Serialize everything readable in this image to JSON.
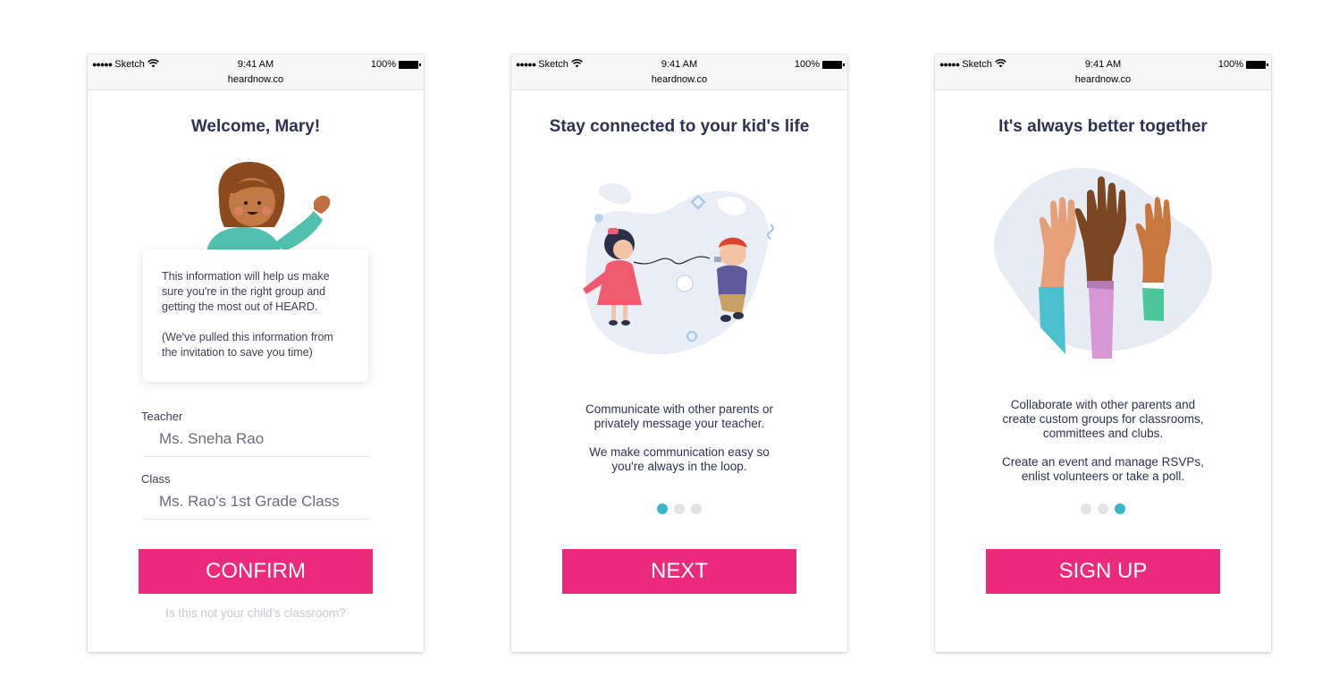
{
  "status_bar": {
    "carrier": "Sketch",
    "time": "9:41 AM",
    "url": "heardnow.co",
    "battery": "100%"
  },
  "screen1": {
    "title": "Welcome, Mary!",
    "info_line1": "This information will help us make sure you're in the right group and getting the most out of HEARD.",
    "info_line2": "(We've pulled this information from the invitation to save you time)",
    "teacher_label": "Teacher",
    "teacher_value": "Ms. Sneha Rao",
    "class_label": "Class",
    "class_value": "Ms. Rao's 1st Grade Class",
    "button": "CONFIRM",
    "link": "Is this not your child's classroom?"
  },
  "screen2": {
    "title": "Stay connected to your kid's life",
    "para1": "Communicate with other parents or privately message your teacher.",
    "para2": "We make communication easy so you're always in the loop.",
    "active_page": 1,
    "button": "NEXT"
  },
  "screen3": {
    "title": "It's always better together",
    "para1": "Collaborate with other parents and create custom groups for classrooms, committees and clubs.",
    "para2": "Create an event and manage RSVPs, enlist volunteers or take a poll.",
    "active_page": 3,
    "button": "SIGN UP"
  },
  "colors": {
    "accent": "#ec2a7b",
    "pager_active": "#37b6cd",
    "title": "#2d3152"
  },
  "icons": [
    "signal-dots-icon",
    "wifi-icon",
    "battery-icon"
  ]
}
